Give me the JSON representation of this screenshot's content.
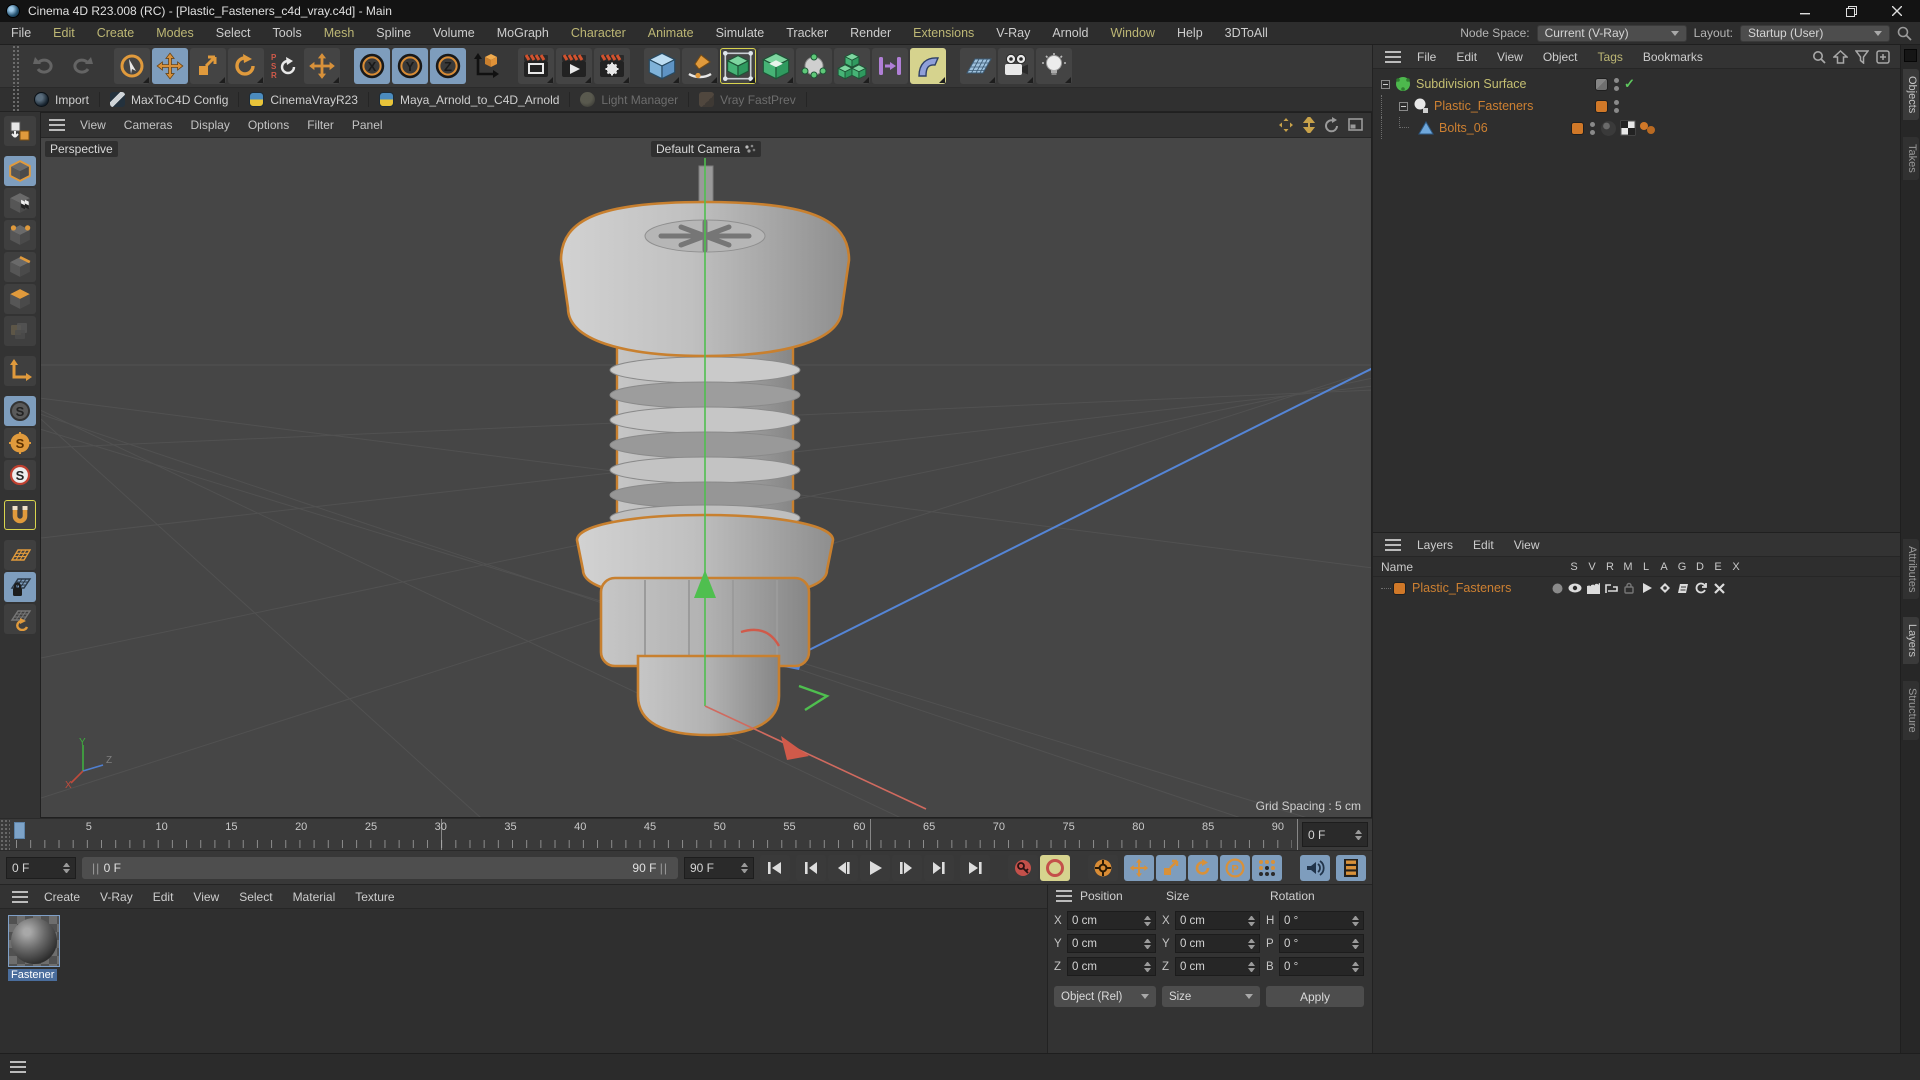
{
  "colors": {
    "accent_orange": "#e09a3c",
    "active_blue": "#7e9dbd",
    "active_yellow": "#d6d38e",
    "selected_text_olive": "#c5bf72",
    "layer_orange": "#cd8032",
    "viewport_bg": "#464646"
  },
  "window": {
    "title": "Cinema 4D R23.008 (RC) - [Plastic_Fasteners_c4d_vray.c4d] - Main"
  },
  "menu_bar": {
    "items": [
      {
        "label": "File"
      },
      {
        "label": "Edit",
        "cls": "accent"
      },
      {
        "label": "Create",
        "cls": "accent"
      },
      {
        "label": "Modes",
        "cls": "accent"
      },
      {
        "label": "Select"
      },
      {
        "label": "Tools"
      },
      {
        "label": "Mesh",
        "cls": "accent"
      },
      {
        "label": "Spline"
      },
      {
        "label": "Volume"
      },
      {
        "label": "MoGraph"
      },
      {
        "label": "Character",
        "cls": "accent"
      },
      {
        "label": "Animate",
        "cls": "accent"
      },
      {
        "label": "Simulate"
      },
      {
        "label": "Tracker"
      },
      {
        "label": "Render"
      },
      {
        "label": "Extensions",
        "cls": "accent"
      },
      {
        "label": "V-Ray"
      },
      {
        "label": "Arnold"
      },
      {
        "label": "Window",
        "cls": "accent"
      },
      {
        "label": "Help"
      },
      {
        "label": "3DToAll"
      }
    ],
    "node_space_label": "Node Space:",
    "node_space_value": "Current (V-Ray)",
    "layout_label": "Layout:",
    "layout_value": "Startup (User)"
  },
  "toolbar": {
    "tools": [
      "undo",
      "redo",
      "live-selection",
      "move",
      "scale",
      "rotate",
      "psr-reset",
      "move-flyout",
      "lock-x",
      "lock-y",
      "lock-z",
      "coordinate-system",
      "render-view",
      "render-to-picture-viewer",
      "edit-render-settings",
      "primitive-cube",
      "spline-pen",
      "subdivision-surface",
      "generators",
      "volume-builder",
      "array",
      "connector",
      "bend-deformer",
      "floor",
      "camera",
      "light"
    ]
  },
  "plugin_bar": {
    "items": [
      {
        "label": "Import",
        "icon": "ic-c4d"
      },
      {
        "label": "MaxToC4D Config",
        "icon": "ic-wrench"
      },
      {
        "label": "CinemaVrayR23",
        "icon": "ic-python"
      },
      {
        "label": "Maya_Arnold_to_C4D_Arnold",
        "icon": "ic-python"
      },
      {
        "label": "Light Manager",
        "icon": "ic-bulb",
        "cls": "disabled"
      },
      {
        "label": "Vray FastPrev",
        "icon": "ic-play",
        "cls": "disabled"
      }
    ]
  },
  "left_toolbar": {
    "tools": [
      "make-editable",
      "model-mode",
      "texture-mode",
      "points-mode",
      "edges-mode",
      "polygons-mode",
      "tweak-mode",
      "enable-axis",
      "snap-off",
      "snap-3d",
      "snap-2d",
      "quantize-magnet",
      "workplane",
      "lock-workplane",
      "workplane-rotate"
    ]
  },
  "viewport": {
    "menu": [
      "View",
      "Cameras",
      "Display",
      "Options",
      "Filter",
      "Panel"
    ],
    "view_label": "Perspective",
    "camera_label": "Default Camera",
    "grid_spacing": "Grid Spacing : 5 cm",
    "axis_labels": {
      "x": "X",
      "y": "Y",
      "z": "Z"
    },
    "corner_tools": [
      "pan-view",
      "zoom-view",
      "rotate-view",
      "toggle-view"
    ]
  },
  "object_manager": {
    "menu": [
      {
        "label": "File"
      },
      {
        "label": "Edit"
      },
      {
        "label": "View"
      },
      {
        "label": "Object"
      },
      {
        "label": "Tags",
        "cls": "accent"
      },
      {
        "label": "Bookmarks"
      }
    ],
    "header_tools": [
      "search",
      "parent-up",
      "filter",
      "add-panel"
    ],
    "side_tabs": [
      "Objects",
      "Takes"
    ],
    "tree": [
      {
        "name": "Subdivision Surface"
      },
      {
        "name": "Plastic_Fasteners"
      },
      {
        "name": "Bolts_06"
      }
    ]
  },
  "layers_panel": {
    "menu": [
      "Layers",
      "Edit",
      "View"
    ],
    "name_header": "Name",
    "columns": [
      "S",
      "V",
      "R",
      "M",
      "L",
      "A",
      "G",
      "D",
      "E",
      "X"
    ],
    "rows": [
      {
        "name": "Plastic_Fasteners"
      }
    ],
    "side_tabs": [
      "Attributes",
      "Layers",
      "Structure"
    ]
  },
  "timeline": {
    "ticks": [
      "0",
      "5",
      "10",
      "15",
      "20",
      "25",
      "30",
      "35",
      "40",
      "45",
      "50",
      "55",
      "60",
      "65",
      "70",
      "75",
      "80",
      "85",
      "90"
    ],
    "frame_box": "0 F",
    "current_frame": "0 F",
    "range_start": "0 F",
    "range_end": "90 F",
    "end_frame": "90 F",
    "transport": [
      "goto-start",
      "prev-key",
      "prev-frame",
      "play",
      "next-frame",
      "next-key",
      "goto-end",
      "record-keyframe",
      "autokeying",
      "keyframe-selection",
      "record-position",
      "record-scale",
      "record-rotation",
      "record-parameter",
      "record-point-level",
      "sound-toggle",
      "render-preview"
    ]
  },
  "materials": {
    "menu": [
      "Create",
      "V-Ray",
      "Edit",
      "View",
      "Select",
      "Material",
      "Texture"
    ],
    "items": [
      {
        "name": "Fastener"
      }
    ]
  },
  "coordinates": {
    "position": {
      "title": "Position",
      "rows": [
        {
          "label": "X",
          "value": "0 cm"
        },
        {
          "label": "Y",
          "value": "0 cm"
        },
        {
          "label": "Z",
          "value": "0 cm"
        }
      ]
    },
    "size": {
      "title": "Size",
      "rows": [
        {
          "label": "X",
          "value": "0 cm"
        },
        {
          "label": "Y",
          "value": "0 cm"
        },
        {
          "label": "Z",
          "value": "0 cm"
        }
      ]
    },
    "rotation": {
      "title": "Rotation",
      "rows": [
        {
          "label": "H",
          "value": "0 °"
        },
        {
          "label": "P",
          "value": "0 °"
        },
        {
          "label": "B",
          "value": "0 °"
        }
      ]
    },
    "mode_dropdown": "Object (Rel)",
    "size_dropdown": "Size",
    "apply_label": "Apply"
  }
}
